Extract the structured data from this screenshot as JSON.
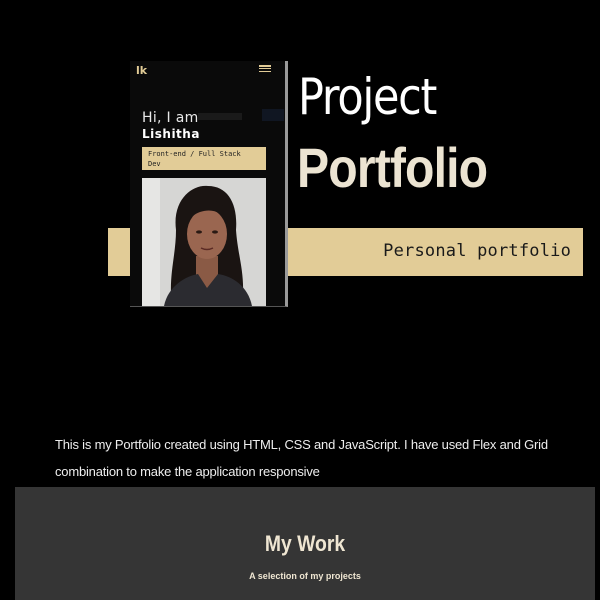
{
  "phone": {
    "logo": "lk",
    "greeting": "Hi, I am",
    "name": "Lishitha",
    "role_line1": "Front-end / Full Stack",
    "role_line2": "Dev",
    "menu_icon": "hamburger-menu-icon",
    "photo_alt": "portrait photo"
  },
  "hero": {
    "title_light": "Project",
    "title_bold": "Portfolio",
    "tagline": "Personal portfolio"
  },
  "about": {
    "description": "This is my Portfolio created using HTML, CSS and JavaScript. I have used Flex and Grid combination to make the application responsive"
  },
  "work": {
    "title": "My Work",
    "subtitle": "A selection of my projects"
  },
  "colors": {
    "background": "#000000",
    "accent": "#e2cc97",
    "title_cream": "#ece4d2",
    "section_gray": "#353535"
  }
}
